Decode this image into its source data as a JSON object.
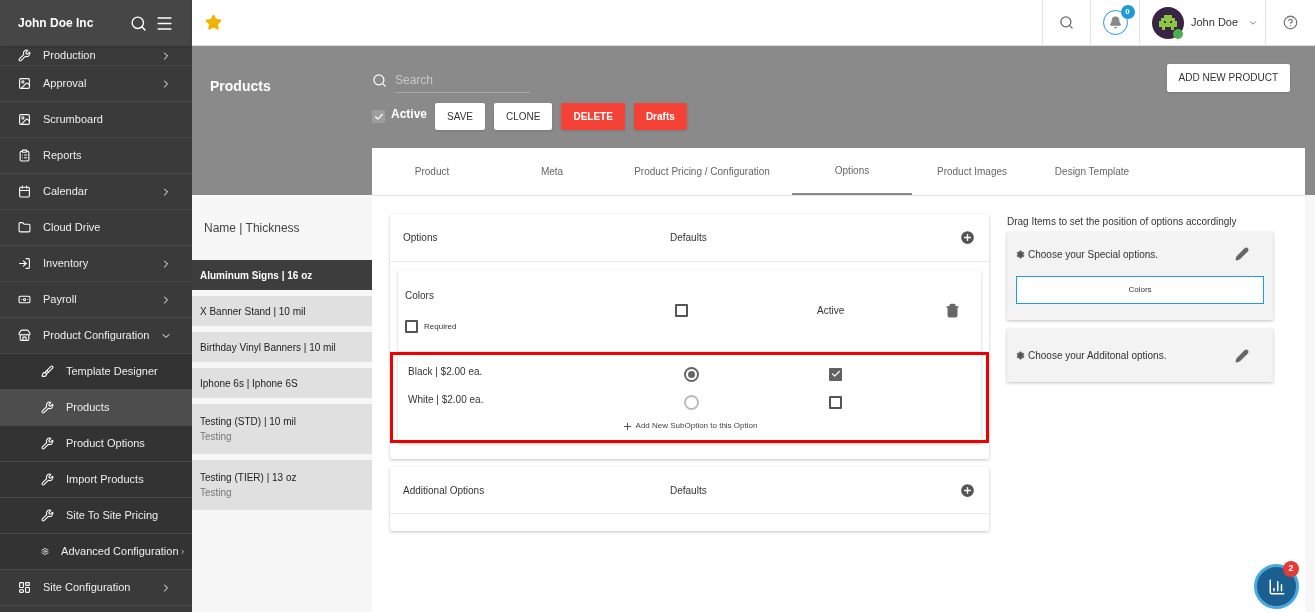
{
  "sidebar": {
    "company": "John Doe Inc",
    "items": [
      {
        "label": "Production",
        "selected": false
      },
      {
        "label": "Approval",
        "selected": false
      },
      {
        "label": "Scrumboard",
        "selected": false
      },
      {
        "label": "Reports",
        "selected": false
      },
      {
        "label": "Calendar",
        "selected": false
      },
      {
        "label": "Cloud Drive",
        "selected": false
      },
      {
        "label": "Inventory",
        "selected": false
      },
      {
        "label": "Payroll",
        "selected": false
      },
      {
        "label": "Product Configuration",
        "selected": false,
        "expanded": true,
        "children": [
          {
            "label": "Template Designer",
            "selected": false
          },
          {
            "label": "Products",
            "selected": true
          },
          {
            "label": "Product Options",
            "selected": false
          },
          {
            "label": "Import Products",
            "selected": false
          },
          {
            "label": "Site To Site Pricing",
            "selected": false
          },
          {
            "label": "Advanced Configuration",
            "selected": false
          }
        ]
      },
      {
        "label": "Site Configuration",
        "selected": false
      }
    ]
  },
  "topbar": {
    "notifications": "0",
    "user": "John Doe"
  },
  "page": {
    "title": "Products",
    "search": {
      "placeholder": "Search"
    },
    "active": {
      "label": "Active",
      "checked": true
    },
    "buttons": [
      {
        "label": "SAVE",
        "kind": "plain"
      },
      {
        "label": "CLONE",
        "kind": "plain"
      },
      {
        "label": "DELETE",
        "kind": "danger"
      },
      {
        "label": "Drafts",
        "kind": "danger"
      }
    ],
    "add_button": "ADD NEW PRODUCT"
  },
  "product_list": {
    "header": "Name | Thickness",
    "items": [
      {
        "name": "Aluminum Signs | 16 oz",
        "selected": true
      },
      {
        "name": "X Banner Stand | 10 mil",
        "selected": false
      },
      {
        "name": "Birthday Vinyl Banners | 10 mil",
        "selected": false
      },
      {
        "name": "Iphone 6s | Iphone 6S",
        "selected": false
      },
      {
        "name": "Testing (STD) | 10 mil",
        "sub": "Testing",
        "selected": false
      },
      {
        "name": "Testing (TIER) | 13 oz",
        "sub": "Testing",
        "selected": false
      }
    ]
  },
  "tabs": [
    {
      "label": "Product",
      "selected": false
    },
    {
      "label": "Meta",
      "selected": false
    },
    {
      "label": "Product Pricing / Configuration",
      "selected": false
    },
    {
      "label": "Options",
      "selected": true
    },
    {
      "label": "Product Images",
      "selected": false
    },
    {
      "label": "Design Template",
      "selected": false
    }
  ],
  "options": {
    "title": "Options",
    "defaults": "Defaults",
    "group": {
      "name": "Colors",
      "default_checked": false,
      "active_label": "Active",
      "required": {
        "label": "Required",
        "checked": false
      },
      "suboptions": [
        {
          "label": "Black | $2.00 ea.",
          "selected": true,
          "active": true
        },
        {
          "label": "White | $2.00 ea.",
          "selected": false,
          "active": false
        }
      ],
      "add_label": "Add New SubOption to this Option"
    }
  },
  "additional": {
    "title": "Additional Options",
    "defaults": "Defaults"
  },
  "ordering": {
    "hint": "Drag Items to set the position of options accordingly",
    "special": {
      "title": "Choose your Special options.",
      "chips": [
        "Colors"
      ]
    },
    "additional": {
      "title": "Choose your Additonal options."
    }
  },
  "chat": {
    "badge": "2"
  }
}
